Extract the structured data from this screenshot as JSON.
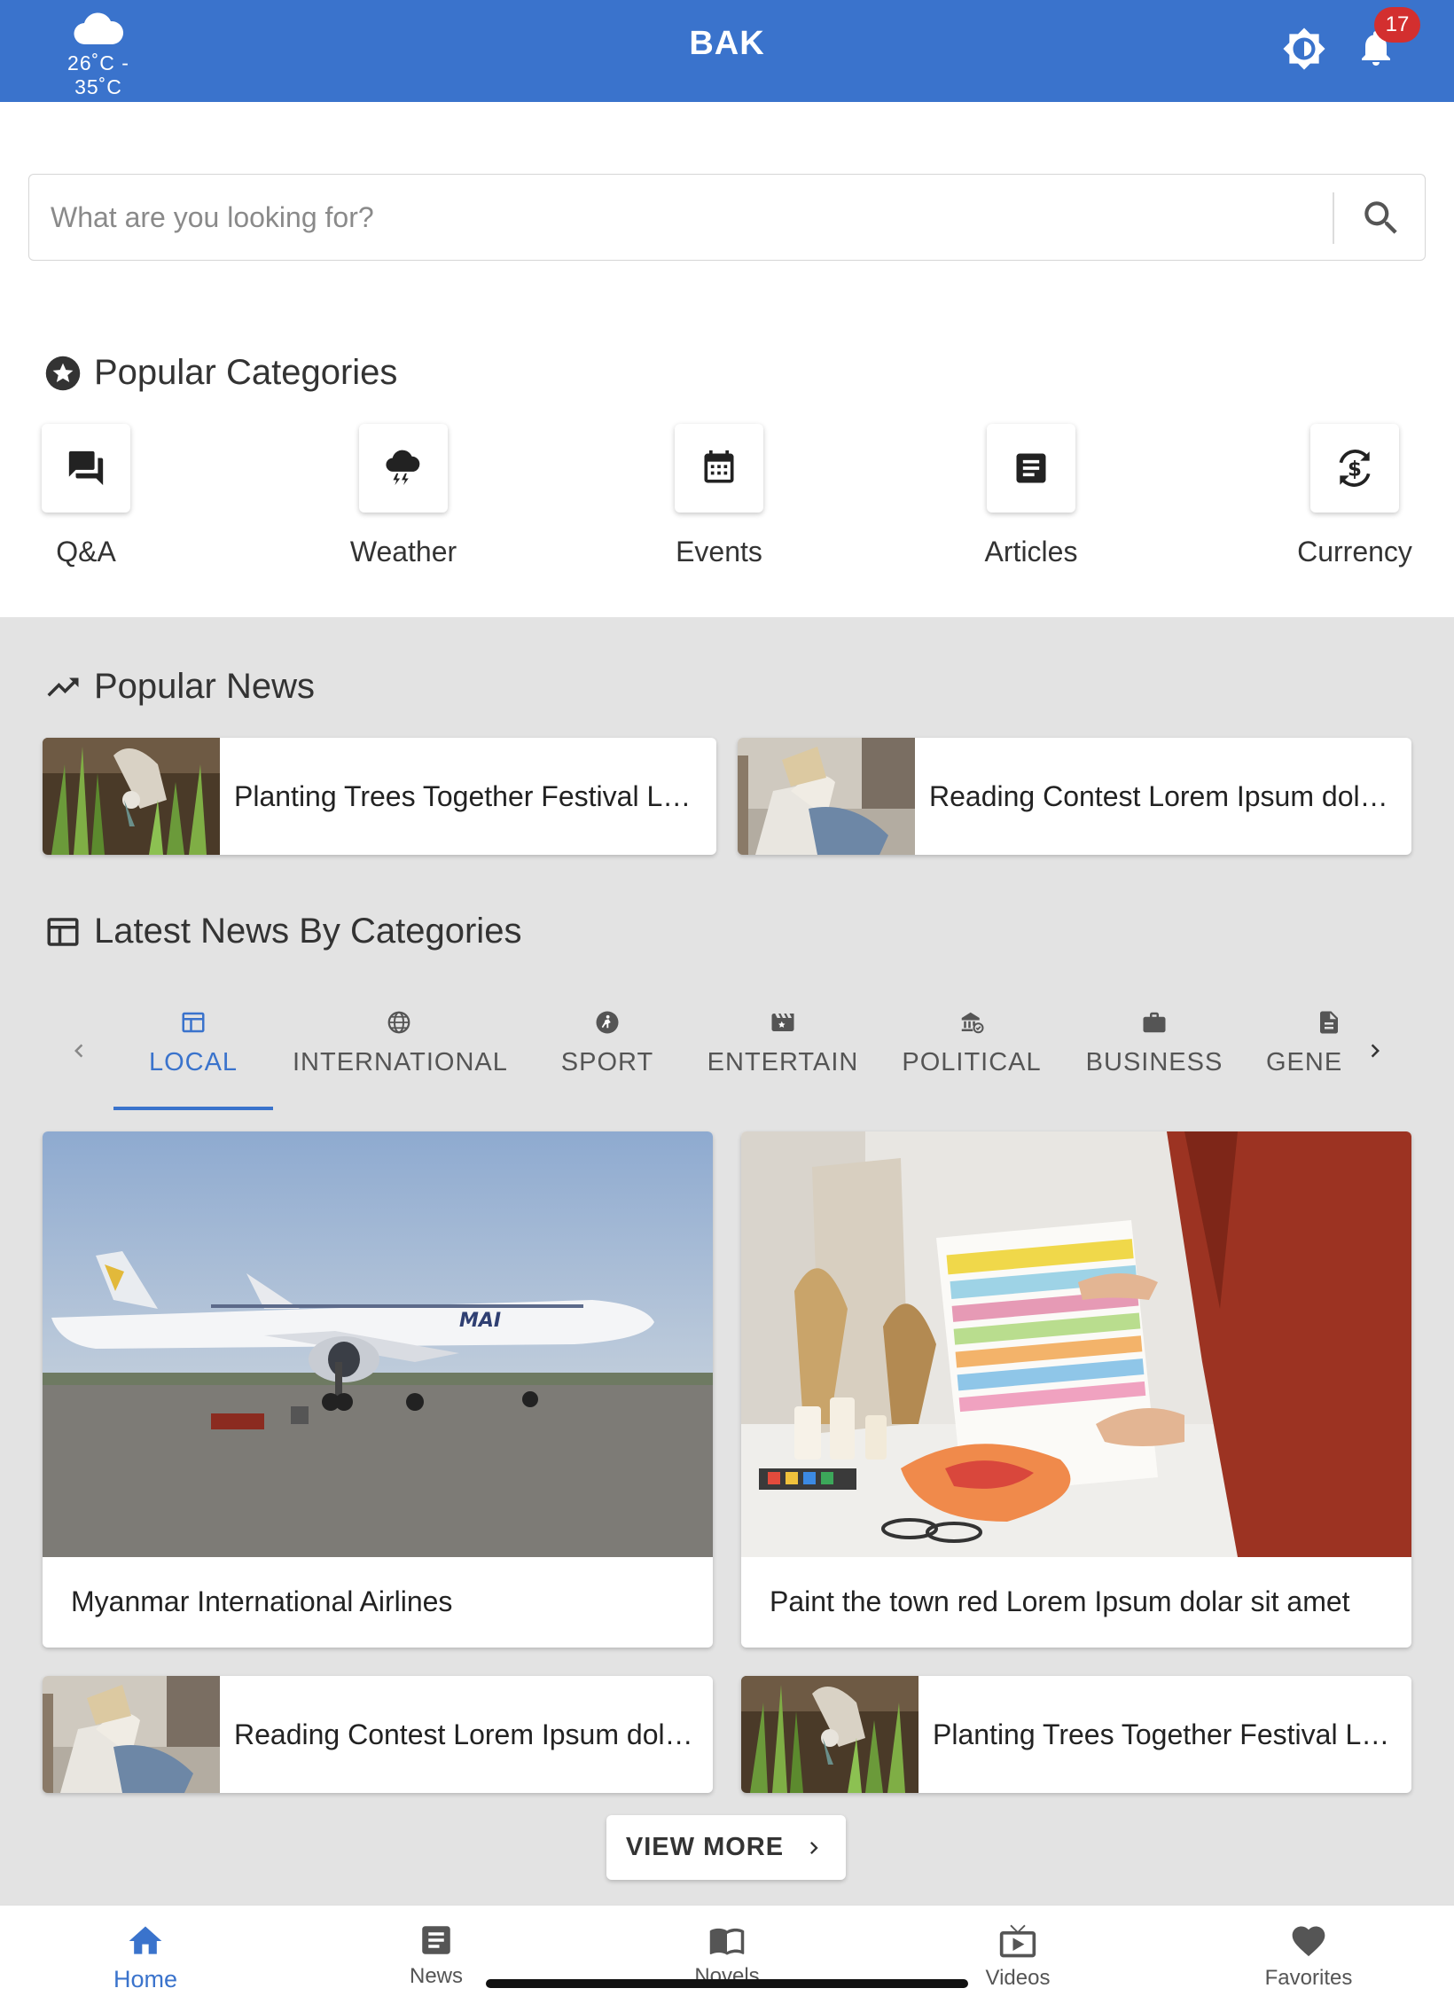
{
  "header": {
    "weather": {
      "temp": "26˚C - 35˚C",
      "icon": "cloud-icon"
    },
    "title": "BAK",
    "notifications_count": "17",
    "color": "#3a73cc"
  },
  "search": {
    "placeholder": "What are you looking for?"
  },
  "popular_categories": {
    "title": "Popular Categories",
    "items": [
      {
        "label": "Q&A",
        "icon": "forum-icon"
      },
      {
        "label": "Weather",
        "icon": "thunderstorm-icon"
      },
      {
        "label": "Events",
        "icon": "calendar-icon"
      },
      {
        "label": "Articles",
        "icon": "article-icon"
      },
      {
        "label": "Currency",
        "icon": "currency-exchange-icon"
      }
    ]
  },
  "popular_news": {
    "title": "Popular News",
    "items": [
      {
        "title": "Planting Trees Together Festival Lorem Ipsum dolar sit amet"
      },
      {
        "title": "Reading Contest Lorem Ipsum dolar sit amet"
      }
    ]
  },
  "latest_news": {
    "title": "Latest News By Categories",
    "tabs": [
      {
        "label": "LOCAL",
        "active": true
      },
      {
        "label": "INTERNATIONAL"
      },
      {
        "label": "SPORT"
      },
      {
        "label": "ENTERTAIN"
      },
      {
        "label": "POLITICAL"
      },
      {
        "label": "BUSINESS"
      },
      {
        "label": "GENEI"
      }
    ],
    "featured": [
      {
        "caption": "Myanmar International Airlines"
      },
      {
        "caption": "Paint the town red Lorem Ipsum dolar sit amet"
      }
    ],
    "list": [
      {
        "title": "Reading Contest Lorem Ipsum dolar sit amet"
      },
      {
        "title": "Planting Trees Together Festival Lorem Ipsum dolar sit amet"
      }
    ],
    "view_more": "VIEW MORE"
  },
  "bottom_nav": [
    {
      "label": "Home",
      "icon": "home-icon",
      "active": true
    },
    {
      "label": "News",
      "icon": "news-icon"
    },
    {
      "label": "Novels",
      "icon": "book-icon"
    },
    {
      "label": "Videos",
      "icon": "tv-icon"
    },
    {
      "label": "Favorites",
      "icon": "heart-icon"
    }
  ]
}
